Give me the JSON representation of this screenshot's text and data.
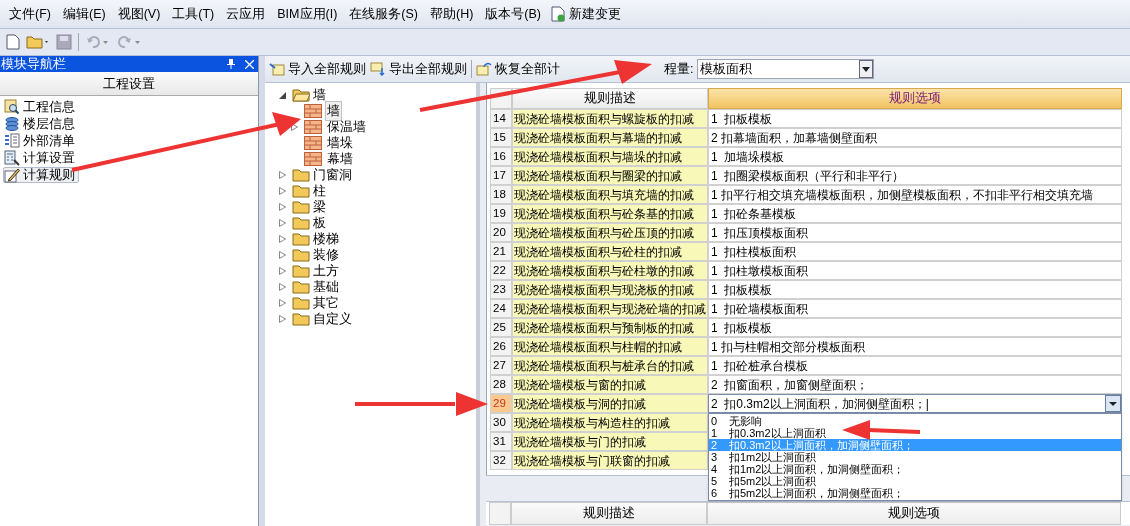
{
  "menu": [
    "文件(F)",
    "编辑(E)",
    "视图(V)",
    "工具(T)",
    "云应用",
    "BIM应用(I)",
    "在线服务(S)",
    "帮助(H)",
    "版本号(B)"
  ],
  "menu_action": "新建变更",
  "nav_panel": {
    "title": "模块导航栏",
    "section": "工程设置",
    "items": [
      {
        "label": "工程信息",
        "selected": false
      },
      {
        "label": "楼层信息",
        "selected": false
      },
      {
        "label": "外部清单",
        "selected": false
      },
      {
        "label": "计算设置",
        "selected": false
      },
      {
        "label": "计算规则",
        "selected": true
      }
    ]
  },
  "toolbar": {
    "import": "导入全部规则",
    "export": "导出全部规则",
    "restore": "恢复全部计",
    "filter_label": "程量:",
    "filter_value": "模板面积"
  },
  "tree": [
    {
      "label": "墙",
      "expanded": true,
      "children": [
        {
          "label": "墙",
          "selected": true,
          "expandable": false
        },
        {
          "label": "保温墙",
          "selected": false,
          "expandable": true
        },
        {
          "label": "墙垛",
          "selected": false,
          "expandable": false
        },
        {
          "label": "幕墙",
          "selected": false,
          "expandable": false
        }
      ]
    },
    {
      "label": "门窗洞",
      "expanded": false
    },
    {
      "label": "柱",
      "expanded": false
    },
    {
      "label": "梁",
      "expanded": false
    },
    {
      "label": "板",
      "expanded": false
    },
    {
      "label": "楼梯",
      "expanded": false
    },
    {
      "label": "装修",
      "expanded": false
    },
    {
      "label": "土方",
      "expanded": false
    },
    {
      "label": "基础",
      "expanded": false
    },
    {
      "label": "其它",
      "expanded": false
    },
    {
      "label": "自定义",
      "expanded": false
    }
  ],
  "table": {
    "columns": [
      "规则描述",
      "规则选项"
    ],
    "rows": [
      {
        "no": "14",
        "desc": "现浇砼墙模板面积与螺旋板的扣减",
        "option": "1  扣板模板",
        "selected": false
      },
      {
        "no": "15",
        "desc": "现浇砼墙模板面积与幕墙的扣减",
        "option": "2 扣幕墙面积，加幕墙侧壁面积",
        "selected": false
      },
      {
        "no": "16",
        "desc": "现浇砼墙模板面积与墙垛的扣减",
        "option": "1  加墙垛模板",
        "selected": false
      },
      {
        "no": "17",
        "desc": "现浇砼墙模板面积与圈梁的扣减",
        "option": "1  扣圈梁模板面积（平行和非平行）",
        "selected": false
      },
      {
        "no": "18",
        "desc": "现浇砼墙模板面积与填充墙的扣减",
        "option": "1 扣平行相交填充墙模板面积，加侧壁模板面积，不扣非平行相交填充墙",
        "selected": false
      },
      {
        "no": "19",
        "desc": "现浇砼墙模板面积与砼条基的扣减",
        "option": "1  扣砼条基模板",
        "selected": false
      },
      {
        "no": "20",
        "desc": "现浇砼墙模板面积与砼压顶的扣减",
        "option": "1  扣压顶模板面积",
        "selected": false
      },
      {
        "no": "21",
        "desc": "现浇砼墙模板面积与砼柱的扣减",
        "option": "1  扣柱模板面积",
        "selected": false
      },
      {
        "no": "22",
        "desc": "现浇砼墙模板面积与砼柱墩的扣减",
        "option": "1  扣柱墩模板面积",
        "selected": false
      },
      {
        "no": "23",
        "desc": "现浇砼墙模板面积与现浇板的扣减",
        "option": "1  扣板模板",
        "selected": false
      },
      {
        "no": "24",
        "desc": "现浇砼墙模板面积与现浇砼墙的扣减",
        "option": "1  扣砼墙模板面积",
        "selected": false
      },
      {
        "no": "25",
        "desc": "现浇砼墙模板面积与预制板的扣减",
        "option": "1  扣板模板",
        "selected": false
      },
      {
        "no": "26",
        "desc": "现浇砼墙模板面积与柱帽的扣减",
        "option": "1 扣与柱帽相交部分模板面积",
        "selected": false
      },
      {
        "no": "27",
        "desc": "现浇砼墙模板面积与桩承台的扣减",
        "option": "1  扣砼桩承台模板",
        "selected": false
      },
      {
        "no": "28",
        "desc": "现浇砼墙模板与窗的扣减",
        "option": "2  扣窗面积，加窗侧壁面积；",
        "selected": false
      },
      {
        "no": "29",
        "desc": "现浇砼墙模板与洞的扣减",
        "option": "2  扣0.3m2以上洞面积，加洞侧壁面积；|",
        "selected": true
      },
      {
        "no": "30",
        "desc": "现浇砼墙模板与构造柱的扣减",
        "option": "",
        "selected": false
      },
      {
        "no": "31",
        "desc": "现浇砼墙模板与门的扣减",
        "option": "",
        "selected": false
      },
      {
        "no": "32",
        "desc": "现浇砼墙模板与门联窗的扣减",
        "option": "",
        "selected": false
      }
    ]
  },
  "dropdown_options": [
    {
      "no": "0",
      "text": "无影响",
      "selected": false
    },
    {
      "no": "1",
      "text": "扣0.3m2以上洞面积",
      "selected": false
    },
    {
      "no": "2",
      "text": "扣0.3m2以上洞面积，加洞侧壁面积；",
      "selected": true
    },
    {
      "no": "3",
      "text": "扣1m2以上洞面积",
      "selected": false
    },
    {
      "no": "4",
      "text": "扣1m2以上洞面积，加洞侧壁面积；",
      "selected": false
    },
    {
      "no": "5",
      "text": "扣5m2以上洞面积",
      "selected": false
    },
    {
      "no": "6",
      "text": "扣5m2以上洞面积，加洞侧壁面积；",
      "selected": false
    }
  ],
  "bottom_table": {
    "columns": [
      "规则描述",
      "规则选项"
    ]
  }
}
